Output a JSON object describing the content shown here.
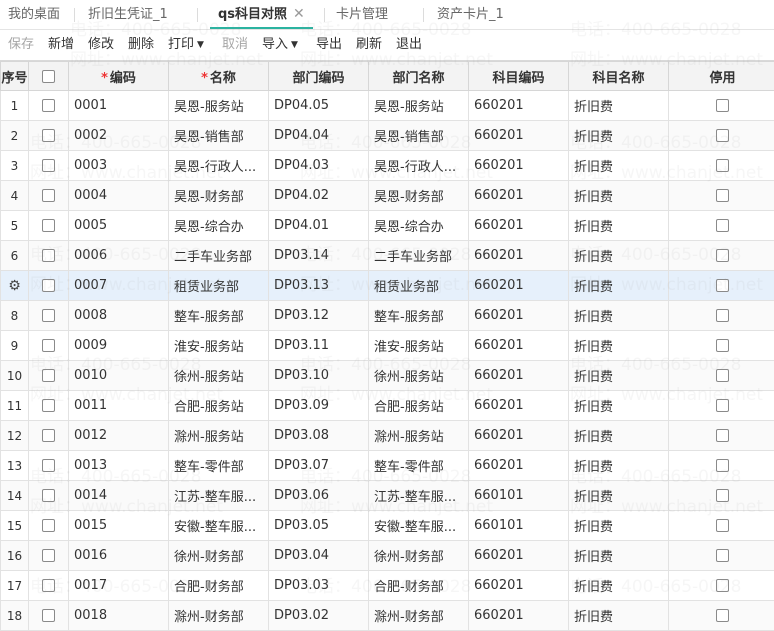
{
  "tabs": [
    {
      "label": "我的桌面"
    },
    {
      "label": "折旧生凭证_1"
    },
    {
      "label": "qs科目对照"
    },
    {
      "label": "卡片管理"
    },
    {
      "label": "资产卡片_1"
    }
  ],
  "tab_close_glyph": "✕",
  "toolbar": {
    "save": "保存",
    "add": "新增",
    "edit": "修改",
    "delete": "删除",
    "print": "打印",
    "cancel": "取消",
    "import": "导入",
    "export": "导出",
    "refresh": "刷新",
    "exit": "退出"
  },
  "columns": {
    "index": "序号",
    "code": "编码",
    "name": "名称",
    "dept_code": "部门编码",
    "dept_name": "部门名称",
    "subject_code": "科目编码",
    "subject_name": "科目名称",
    "stop": "停用"
  },
  "required_mark": "*",
  "gear_glyph": "⚙",
  "rows": [
    {
      "idx": "1",
      "code": "0001",
      "name": "昊恩-服务站",
      "dept_code": "DP04.05",
      "dept_name": "昊恩-服务站",
      "subject_code": "660201",
      "subject_name": "折旧费"
    },
    {
      "idx": "2",
      "code": "0002",
      "name": "昊恩-销售部",
      "dept_code": "DP04.04",
      "dept_name": "昊恩-销售部",
      "subject_code": "660201",
      "subject_name": "折旧费"
    },
    {
      "idx": "3",
      "code": "0003",
      "name": "昊恩-行政人...",
      "dept_code": "DP04.03",
      "dept_name": "昊恩-行政人...",
      "subject_code": "660201",
      "subject_name": "折旧费"
    },
    {
      "idx": "4",
      "code": "0004",
      "name": "昊恩-财务部",
      "dept_code": "DP04.02",
      "dept_name": "昊恩-财务部",
      "subject_code": "660201",
      "subject_name": "折旧费"
    },
    {
      "idx": "5",
      "code": "0005",
      "name": "昊恩-综合办",
      "dept_code": "DP04.01",
      "dept_name": "昊恩-综合办",
      "subject_code": "660201",
      "subject_name": "折旧费"
    },
    {
      "idx": "6",
      "code": "0006",
      "name": "二手车业务部",
      "dept_code": "DP03.14",
      "dept_name": "二手车业务部",
      "subject_code": "660201",
      "subject_name": "折旧费"
    },
    {
      "idx": "7",
      "code": "0007",
      "name": "租赁业务部",
      "dept_code": "DP03.13",
      "dept_name": "租赁业务部",
      "subject_code": "660201",
      "subject_name": "折旧费"
    },
    {
      "idx": "8",
      "code": "0008",
      "name": "整车-服务部",
      "dept_code": "DP03.12",
      "dept_name": "整车-服务部",
      "subject_code": "660201",
      "subject_name": "折旧费"
    },
    {
      "idx": "9",
      "code": "0009",
      "name": "淮安-服务站",
      "dept_code": "DP03.11",
      "dept_name": "淮安-服务站",
      "subject_code": "660201",
      "subject_name": "折旧费"
    },
    {
      "idx": "10",
      "code": "0010",
      "name": "徐州-服务站",
      "dept_code": "DP03.10",
      "dept_name": "徐州-服务站",
      "subject_code": "660201",
      "subject_name": "折旧费"
    },
    {
      "idx": "11",
      "code": "0011",
      "name": "合肥-服务站",
      "dept_code": "DP03.09",
      "dept_name": "合肥-服务站",
      "subject_code": "660201",
      "subject_name": "折旧费"
    },
    {
      "idx": "12",
      "code": "0012",
      "name": "滁州-服务站",
      "dept_code": "DP03.08",
      "dept_name": "滁州-服务站",
      "subject_code": "660201",
      "subject_name": "折旧费"
    },
    {
      "idx": "13",
      "code": "0013",
      "name": "整车-零件部",
      "dept_code": "DP03.07",
      "dept_name": "整车-零件部",
      "subject_code": "660201",
      "subject_name": "折旧费"
    },
    {
      "idx": "14",
      "code": "0014",
      "name": "江苏-整车服...",
      "dept_code": "DP03.06",
      "dept_name": "江苏-整车服...",
      "subject_code": "660101",
      "subject_name": "折旧费"
    },
    {
      "idx": "15",
      "code": "0015",
      "name": "安徽-整车服...",
      "dept_code": "DP03.05",
      "dept_name": "安徽-整车服...",
      "subject_code": "660101",
      "subject_name": "折旧费"
    },
    {
      "idx": "16",
      "code": "0016",
      "name": "徐州-财务部",
      "dept_code": "DP03.04",
      "dept_name": "徐州-财务部",
      "subject_code": "660201",
      "subject_name": "折旧费"
    },
    {
      "idx": "17",
      "code": "0017",
      "name": "合肥-财务部",
      "dept_code": "DP03.03",
      "dept_name": "合肥-财务部",
      "subject_code": "660201",
      "subject_name": "折旧费"
    },
    {
      "idx": "18",
      "code": "0018",
      "name": "滁州-财务部",
      "dept_code": "DP03.02",
      "dept_name": "滁州-财务部",
      "subject_code": "660201",
      "subject_name": "折旧费"
    }
  ],
  "selected_row": "7",
  "watermark": [
    "电话：400-665-0028",
    "网址：www.chanjet.net"
  ]
}
